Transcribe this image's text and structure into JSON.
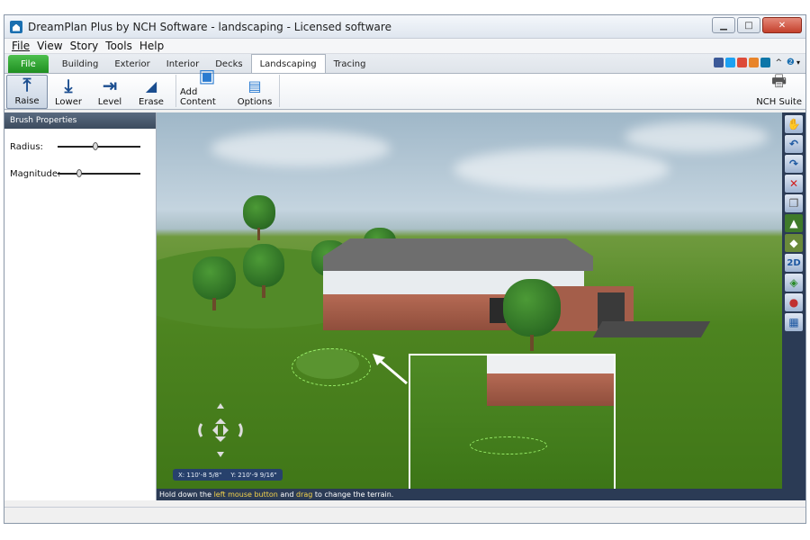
{
  "window": {
    "title": "DreamPlan Plus by NCH Software - landscaping - Licensed software"
  },
  "menu": [
    "File",
    "View",
    "Story",
    "Tools",
    "Help"
  ],
  "tabs": [
    "File",
    "Building",
    "Exterior",
    "Interior",
    "Decks",
    "Landscaping",
    "Tracing"
  ],
  "active_tab": "Landscaping",
  "toolbar": {
    "raise": "Raise",
    "lower": "Lower",
    "level": "Level",
    "erase": "Erase",
    "add_content": "Add Content",
    "options": "Options",
    "nch_suite": "NCH Suite"
  },
  "brush": {
    "header": "Brush Properties",
    "radius_label": "Radius:",
    "radius_value": 0.35,
    "magnitude_label": "Magnitude:",
    "magnitude_value": 0.25
  },
  "viewport": {
    "coords_x": "X: 110'-8 5/8\"",
    "coords_y": "Y: 210'-9 9/16\"",
    "status_pre": "Hold down the ",
    "status_hl1": "left mouse button",
    "status_mid": " and ",
    "status_hl2": "drag",
    "status_post": " to change the terrain."
  },
  "right_tools": [
    "hand-icon",
    "rotate-left-icon",
    "rotate-right-icon",
    "delete-icon",
    "copy-icon",
    "terrain-icon",
    "texture-icon",
    "2D",
    "layers-icon",
    "paint-icon",
    "grid-icon"
  ],
  "colors": {
    "file_tab": "#2a9a2c",
    "side_header": "#4a5a70",
    "viewport_bar": "#2b3b55"
  }
}
